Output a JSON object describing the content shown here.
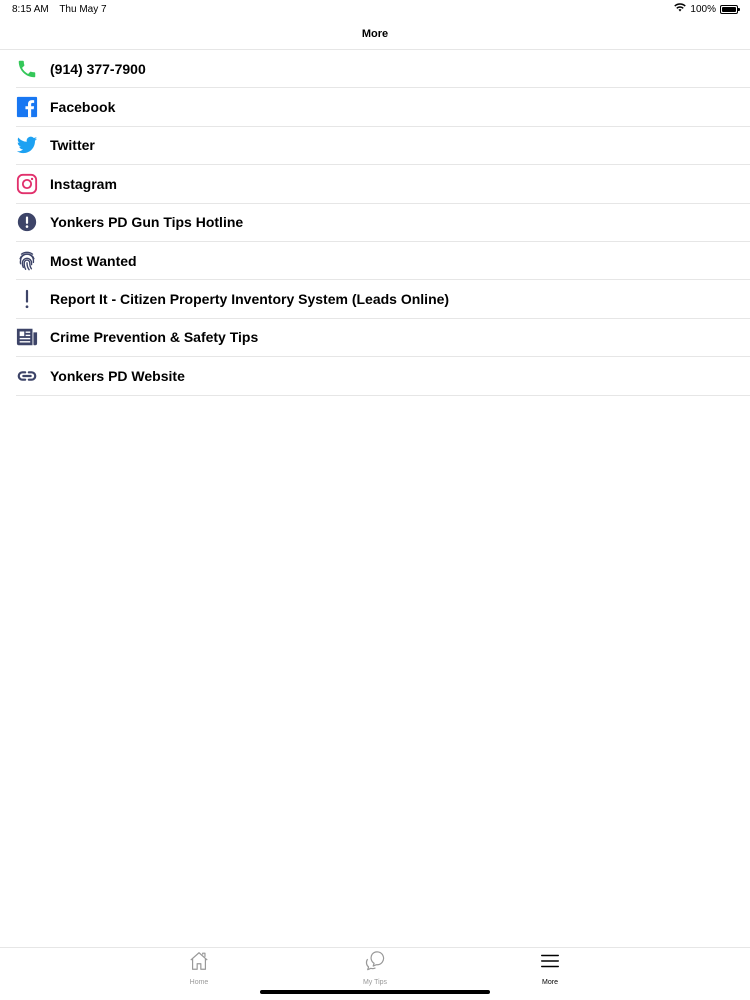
{
  "status_bar": {
    "time": "8:15 AM",
    "date": "Thu May 7",
    "battery_text": "100%",
    "battery_level": 1.0
  },
  "nav": {
    "title": "More"
  },
  "colors": {
    "phone": "#34c759",
    "facebook": "#1877f2",
    "twitter": "#1da1f2",
    "instagram": "#e1306c",
    "navy": "#3d4468",
    "tab_inactive": "#999999",
    "tab_active": "#000000"
  },
  "items": [
    {
      "label": "(914) 377-7900",
      "icon": "phone-icon"
    },
    {
      "label": "Facebook",
      "icon": "facebook-icon"
    },
    {
      "label": "Twitter",
      "icon": "twitter-icon"
    },
    {
      "label": "Instagram",
      "icon": "instagram-icon"
    },
    {
      "label": "Yonkers PD Gun Tips Hotline",
      "icon": "alert-circle-icon"
    },
    {
      "label": "Most Wanted",
      "icon": "fingerprint-icon"
    },
    {
      "label": "Report It - Citizen Property Inventory System (Leads Online)",
      "icon": "exclamation-icon"
    },
    {
      "label": "Crime Prevention & Safety Tips",
      "icon": "newspaper-icon"
    },
    {
      "label": "Yonkers PD Website",
      "icon": "link-icon"
    }
  ],
  "tabs": [
    {
      "label": "Home",
      "icon": "home-icon",
      "active": false
    },
    {
      "label": "My Tips",
      "icon": "chat-bubbles-icon",
      "active": false
    },
    {
      "label": "More",
      "icon": "menu-icon",
      "active": true
    }
  ]
}
